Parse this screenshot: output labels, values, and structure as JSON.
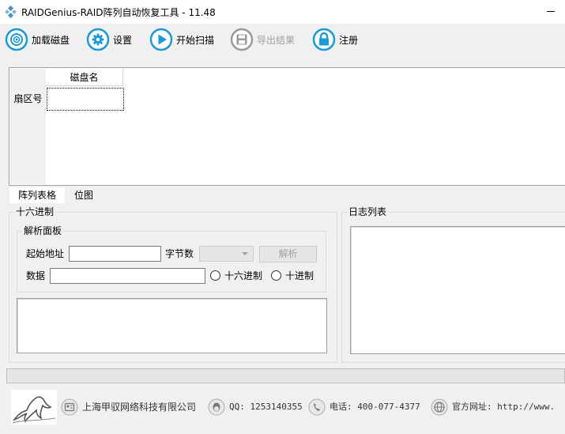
{
  "window": {
    "title": "RAIDGenius-RAID阵列自动恢复工具 - 11.48"
  },
  "toolbar": {
    "load_disk": "加载磁盘",
    "settings": "设置",
    "start_scan": "开始扫描",
    "export_results": "导出结果",
    "register": "注册"
  },
  "grid": {
    "column_header": "磁盘名",
    "row_header": "扇区号"
  },
  "tabs": {
    "array_table": "阵列表格",
    "bitmap": "位图"
  },
  "hex_panel": {
    "title": "十六进制",
    "parse_panel": {
      "title": "解析面板",
      "start_address_label": "起始地址",
      "start_address_value": "",
      "byte_count_label": "字节数",
      "byte_count_value": "",
      "parse_button": "解析",
      "data_label": "数据",
      "data_value": "",
      "radio_hex": "十六进制",
      "radio_decimal": "十进制"
    }
  },
  "log_panel": {
    "title": "日志列表"
  },
  "progress": {
    "value": 0
  },
  "footer": {
    "company": "上海甲驭网络科技有限公司",
    "qq": "QQ: 1253140355",
    "phone": "电话: 400-077-4377",
    "website": "官方网址: http://www."
  },
  "colors": {
    "icon_accent": "#1a9ad6",
    "icon_disabled": "#9a9a9a",
    "progress_fill": "#06b025"
  },
  "icons": {
    "load_disk": "target-disk-icon",
    "settings": "gear-icon",
    "start_scan": "play-icon",
    "export_results": "floppy-disk-icon",
    "register": "lock-icon",
    "company": "id-card-icon",
    "qq": "qq-penguin-icon",
    "phone": "phone-icon",
    "website": "globe-icon"
  }
}
